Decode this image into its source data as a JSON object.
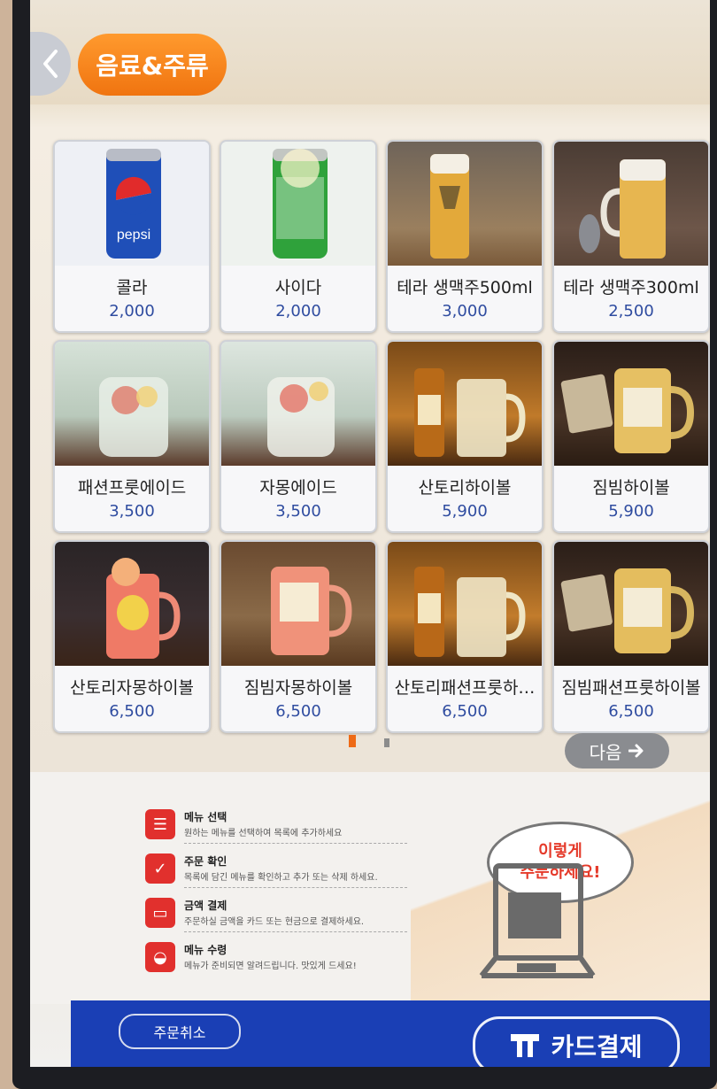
{
  "header": {
    "category": "음료&주류"
  },
  "menu_items": [
    {
      "name": "콜라",
      "price": "2,000",
      "thumb": "pepsi-can"
    },
    {
      "name": "사이다",
      "price": "2,000",
      "thumb": "cider-can"
    },
    {
      "name": "테라 생맥주500ml",
      "price": "3,000",
      "thumb": "beer-glass"
    },
    {
      "name": "테라 생맥주300ml",
      "price": "2,500",
      "thumb": "beer-mug"
    },
    {
      "name": "패션프룻에이드",
      "price": "3,500",
      "thumb": "ade-glass"
    },
    {
      "name": "자몽에이드",
      "price": "3,500",
      "thumb": "ade-glass"
    },
    {
      "name": "산토리하이볼",
      "price": "5,900",
      "thumb": "whisky-mug"
    },
    {
      "name": "짐빔하이볼",
      "price": "5,900",
      "thumb": "whisky-mug"
    },
    {
      "name": "산토리자몽하이볼",
      "price": "6,500",
      "thumb": "pink-highball"
    },
    {
      "name": "짐빔자몽하이볼",
      "price": "6,500",
      "thumb": "pink-highball"
    },
    {
      "name": "산토리패션프룻하…",
      "price": "6,500",
      "thumb": "whisky-mug"
    },
    {
      "name": "짐빔패션프룻하이볼",
      "price": "6,500",
      "thumb": "whisky-mug"
    }
  ],
  "pagination": {
    "next_label": "다음"
  },
  "guide": {
    "steps": [
      {
        "title": "메뉴 선택",
        "desc": "원하는 메뉴를 선택하여 목록에 추가하세요"
      },
      {
        "title": "주문 확인",
        "desc": "목록에 담긴 메뉴를 확인하고 추가 또는 삭제 하세요."
      },
      {
        "title": "금액 결제",
        "desc": "주문하실 금액을 카드 또는 현금으로 결제하세요."
      },
      {
        "title": "메뉴 수령",
        "desc": "메뉴가 준비되면 알려드립니다. 맛있게 드세요!"
      }
    ],
    "bubble_line1": "이렇게",
    "bubble_line2": "주문하세요!"
  },
  "footer": {
    "cancel_label": "주문취소",
    "card_pay_label": "카드결제"
  },
  "colors": {
    "accent_orange": "#f07410",
    "price_blue": "#2f4ca0",
    "footer_blue": "#1a3fb5",
    "guide_red": "#e1302d"
  }
}
